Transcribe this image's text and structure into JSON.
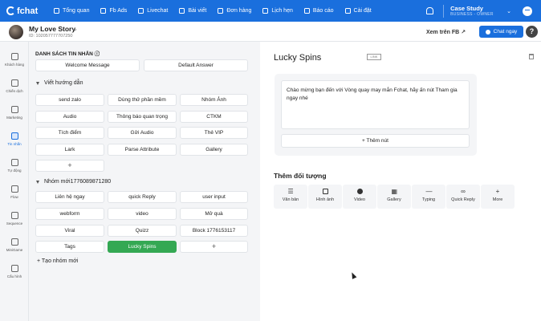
{
  "topbar": {
    "logo": "fchat",
    "nav": [
      "Tổng quan",
      "Fb Ads",
      "Livechat",
      "Bài viết",
      "Đơn hàng",
      "Lịch hẹn",
      "Báo cáo",
      "Cài đặt"
    ],
    "account_name": "Case Study",
    "account_role": "BUSINESS - OWNER"
  },
  "page": {
    "name": "My Love Story",
    "id": "ID: 102057777707250",
    "view_fb": "Xem trên FB",
    "chat_now": "Chat ngay",
    "help": "?"
  },
  "sidebar": [
    "Khách hàng",
    "Chiến dịch",
    "Marketing",
    "Tin nhắn",
    "Tự động",
    "Flow",
    "Sequence",
    "MiniGame",
    "Cấu hình"
  ],
  "left": {
    "section_title": "DANH SÁCH TIN NHẮN",
    "top_buttons": [
      "Welcome Message",
      "Default Answer"
    ],
    "plus": "+",
    "group1": {
      "title": "Viết hướng dẫn",
      "items": [
        "send zalo",
        "Dùng thử phần mềm",
        "Nhóm Ảnh",
        "Audio",
        "Thông báo quan trọng",
        "CTKM",
        "Tích điểm",
        "Gửi Audio",
        "Thẻ VIP",
        "Lark",
        "Parse Attribute",
        "Gallery"
      ]
    },
    "group2": {
      "title": "Nhóm mới1776089871280",
      "items": [
        "Liên hệ ngay",
        "quick Reply",
        "user input",
        "webform",
        "video",
        "Mở quà",
        "Viral",
        "Quizz",
        "Block 1776153117",
        "Tags",
        "Lucky Spins"
      ]
    },
    "new_group": "+ Tạo nhóm mới"
  },
  "right": {
    "title": "Lucky Spins",
    "link_tag": "LINK",
    "message": "Chào mừng bạn đến với Vòng quay may mắn Fchat, hãy ấn nút Tham gia ngay nhé",
    "add_button": "+ Thêm nút",
    "add_object": "Thêm đối tượng",
    "objects": [
      "Văn bản",
      "Hình ảnh",
      "Video",
      "Gallery",
      "Typing",
      "Quick Reply",
      "More"
    ]
  },
  "colors": {
    "primary": "#1a6fdd",
    "active_block": "#34a853"
  }
}
